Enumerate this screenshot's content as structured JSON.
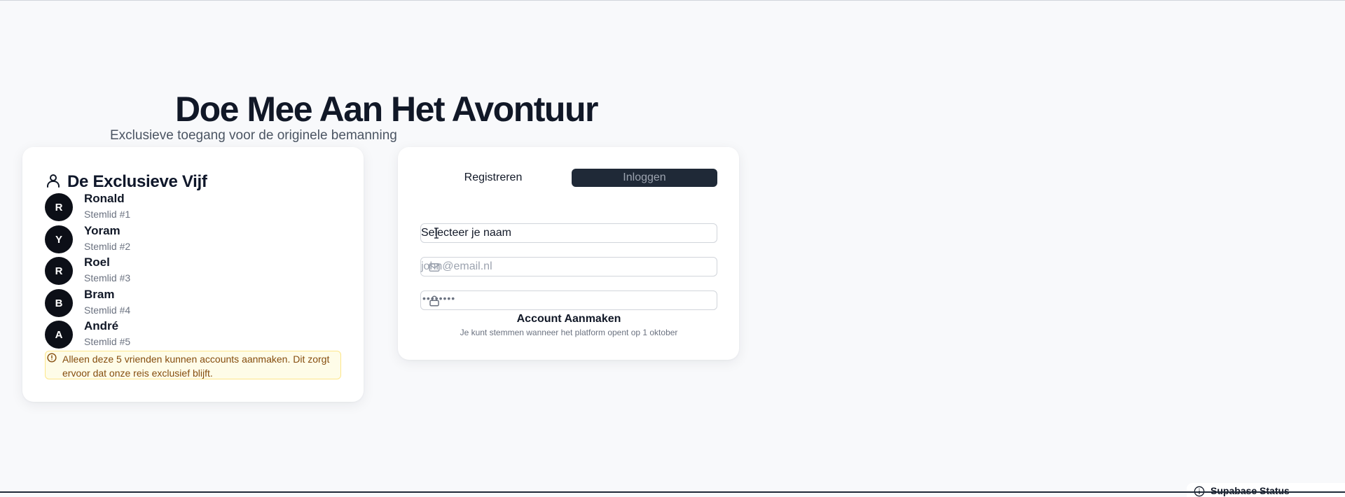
{
  "hero": {
    "title": "Doe Mee Aan Het Avontuur",
    "subtitle": "Exclusieve toegang voor de originele bemanning"
  },
  "members_card": {
    "icon": "user-icon",
    "title": "De Exclusieve Vijf",
    "members": [
      {
        "initial": "R",
        "name": "Ronald",
        "role": "Stemlid #1"
      },
      {
        "initial": "Y",
        "name": "Yoram",
        "role": "Stemlid #2"
      },
      {
        "initial": "R",
        "name": "Roel",
        "role": "Stemlid #3"
      },
      {
        "initial": "B",
        "name": "Bram",
        "role": "Stemlid #4"
      },
      {
        "initial": "A",
        "name": "André",
        "role": "Stemlid #5"
      }
    ],
    "notice": "Alleen deze 5 vrienden kunnen accounts aanmaken. Dit zorgt ervoor dat onze reis exclusief blijft."
  },
  "auth_card": {
    "tabs": {
      "register": "Registreren",
      "login": "Inloggen"
    },
    "name_select": {
      "value": "Selecteer je naam"
    },
    "email": {
      "placeholder": "john@email.nl"
    },
    "password": {
      "masked": "••••••••"
    },
    "submit": "Account Aanmaken",
    "hint": "Je kunt stemmen wanneer het platform opent op 1 oktober"
  },
  "status_chip": {
    "label": "Supabase Status"
  },
  "colors": {
    "background": "#f8f9fb",
    "avatar": "#0c0f17",
    "active_tab": "#1f2937",
    "notice_bg": "#fefce8",
    "notice_text": "#854d0e"
  }
}
